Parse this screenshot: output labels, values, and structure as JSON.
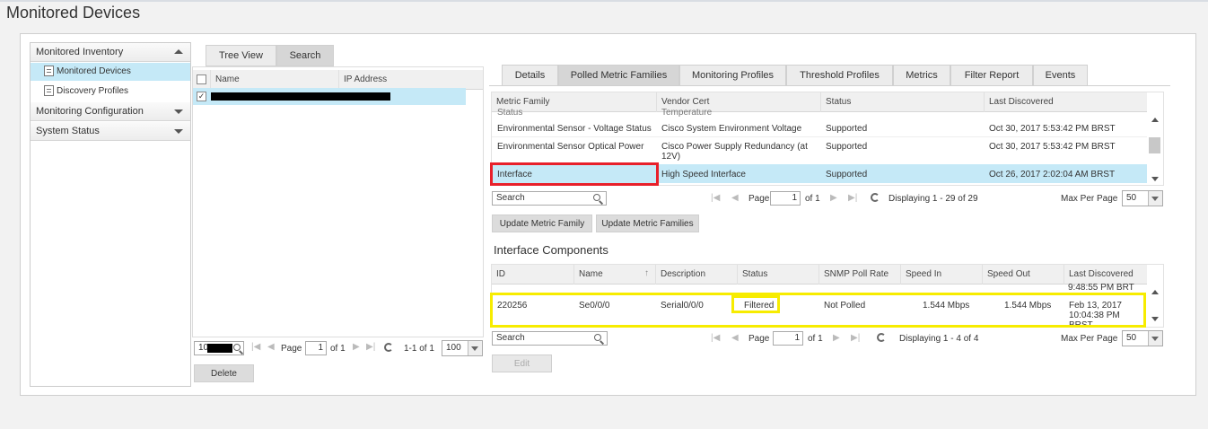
{
  "page": {
    "title": "Monitored Devices"
  },
  "nav": {
    "sections": [
      {
        "label": "Monitored Inventory"
      },
      {
        "label": "Monitoring Configuration"
      },
      {
        "label": "System Status"
      }
    ],
    "items": [
      {
        "label": "Monitored Devices",
        "selected": true
      },
      {
        "label": "Discovery Profiles",
        "selected": false
      }
    ]
  },
  "device_panel": {
    "tabs": [
      "Tree View",
      "Search"
    ],
    "columns": [
      "Name",
      "IP Address"
    ],
    "search_value": "10",
    "paging": {
      "page_label": "Page",
      "page": "1",
      "of": "of 1",
      "range": "1-1 of 1",
      "per_page": "100"
    },
    "delete_label": "Delete"
  },
  "detail_tabs": [
    "Details",
    "Polled Metric Families",
    "Monitoring Profiles",
    "Threshold Profiles",
    "Metrics",
    "Filter Report",
    "Events"
  ],
  "metric_families": {
    "columns": [
      "Metric Family",
      "Vendor Cert",
      "Status",
      "Last Discovered"
    ],
    "partial_row": {
      "family": "Status",
      "vendor": "Temperature"
    },
    "rows": [
      {
        "family": "Environmental Sensor - Voltage Status",
        "vendor": "Cisco System Environment Voltage",
        "status": "Supported",
        "last": "Oct 30, 2017 5:53:42 PM BRST"
      },
      {
        "family": "Environmental Sensor Optical Power",
        "vendor": "Cisco Power Supply Redundancy (at 12V)",
        "status": "Supported",
        "last": "Oct 30, 2017 5:53:42 PM BRST"
      },
      {
        "family": "Interface",
        "vendor": "High Speed Interface",
        "status": "Supported",
        "last": "Oct 26, 2017 2:02:04 AM BRST"
      }
    ],
    "search_placeholder": "Search",
    "paging": {
      "page_label": "Page",
      "page": "1",
      "of": "of 1",
      "display": "Displaying 1 - 29 of 29",
      "max_label": "Max Per Page",
      "max": "50"
    },
    "buttons": [
      "Update Metric Family",
      "Update Metric Families"
    ]
  },
  "components": {
    "title": "Interface Components",
    "columns": [
      "ID",
      "Name",
      "Description",
      "Status",
      "SNMP Poll Rate",
      "Speed In",
      "Speed Out",
      "Last Discovered"
    ],
    "partial_last": "9:48:55 PM BRT",
    "rows": [
      {
        "id": "220256",
        "name": "Se0/0/0",
        "description": "Serial0/0/0",
        "status": "Filtered",
        "poll": "Not Polled",
        "speed_in": "1.544 Mbps",
        "speed_out": "1.544 Mbps",
        "last_l1": "Feb 13, 2017",
        "last_l2": "10:04:38 PM",
        "last_l3": "BRST"
      }
    ],
    "search_placeholder": "Search",
    "paging": {
      "page_label": "Page",
      "page": "1",
      "of": "of 1",
      "display": "Displaying 1 - 4 of 4",
      "max_label": "Max Per Page",
      "max": "50"
    },
    "edit_label": "Edit"
  },
  "colors": {
    "selected_row": "#c5e9f7",
    "red_highlight": "#e8202a",
    "yellow_highlight": "#f7ec00"
  }
}
